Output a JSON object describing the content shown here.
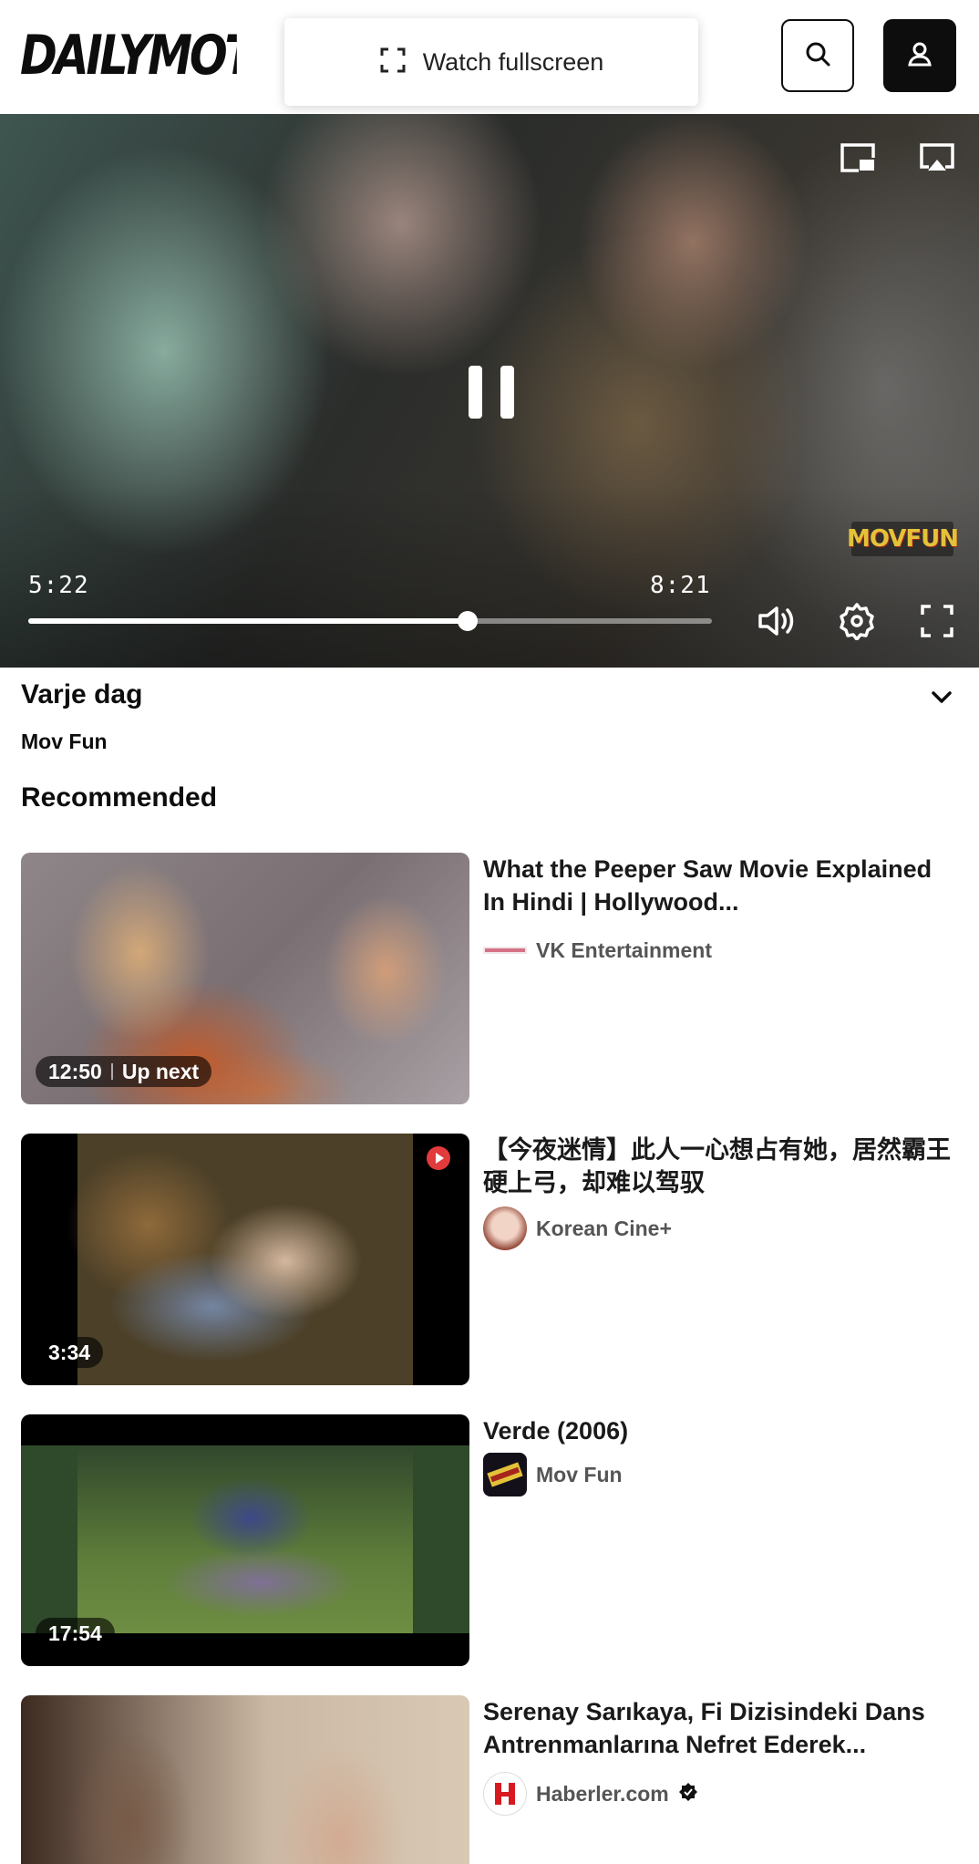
{
  "header": {
    "logo_text": "DAILYMOTION",
    "fullscreen_prompt": "Watch fullscreen",
    "search_icon": "search-icon",
    "account_icon": "user-icon"
  },
  "player": {
    "current_time": "5:22",
    "duration": "8:21",
    "progress_fraction": 0.643,
    "watermark": "MOVFUN",
    "icons": [
      "picture-in-picture-icon",
      "airplay-icon",
      "pause-icon",
      "volume-icon",
      "settings-icon",
      "fullscreen-icon"
    ]
  },
  "video": {
    "title": "Varje dag",
    "channel": "Mov Fun"
  },
  "recommended": {
    "heading": "Recommended",
    "items": [
      {
        "duration": "12:50",
        "badge_extra": "Up next",
        "title": "What the Peeper Saw Movie Explained In Hindi | Hollywood...",
        "channel": "VK Entertainment"
      },
      {
        "duration": "3:34",
        "title": "【今夜迷情】此人一心想占有她，居然霸王硬上弓，却难以驾驭",
        "channel": "Korean Cine+"
      },
      {
        "duration": "17:54",
        "title": "Verde (2006)",
        "channel": "Mov Fun"
      },
      {
        "duration": "",
        "title": "Serenay Sarıkaya, Fi Dizisindeki Dans Antrenmanlarına Nefret Ederek...",
        "channel": "Haberler.com",
        "verified": true
      }
    ]
  },
  "colors": {
    "text": "#0d0d0d",
    "muted": "#555555",
    "background": "#ffffff"
  }
}
